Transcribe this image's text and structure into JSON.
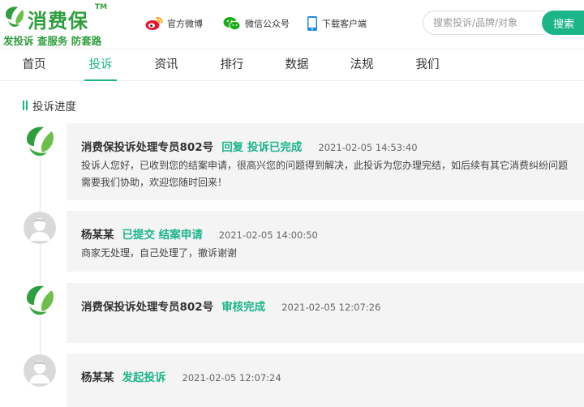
{
  "brand": {
    "title": "消费保",
    "tm": "TM",
    "slogan": "发投诉 查服务 防套路"
  },
  "toplinks": {
    "weibo": "官方微博",
    "wechat": "微信公众号",
    "app": "下载客户端"
  },
  "search": {
    "placeholder": "搜索投诉/品牌/对象",
    "button": "搜索"
  },
  "nav": {
    "items": [
      {
        "label": "首页"
      },
      {
        "label": "投诉"
      },
      {
        "label": "资讯"
      },
      {
        "label": "排行"
      },
      {
        "label": "数据"
      },
      {
        "label": "法规"
      },
      {
        "label": "我们"
      }
    ],
    "active": "投诉"
  },
  "progress": {
    "title": "投诉进度",
    "entries": [
      {
        "avatar": "xiaofeibao-logo",
        "name": "消费保投诉处理专员802号",
        "status": "回复 投诉已完成",
        "time": "2021-02-05 14:53:40",
        "message": "投诉人您好，已收到您的结案申请，很高兴您的问题得到解决，此投诉为您办理完结，如后续有其它消费纠纷问题需要我们协助，欢迎您随时回来！"
      },
      {
        "avatar": "user-avatar",
        "name": "杨某某",
        "status": "已提交 结案申请",
        "time": "2021-02-05 14:00:50",
        "message": "商家无处理，自己处理了，撤诉谢谢"
      },
      {
        "avatar": "xiaofeibao-logo",
        "name": "消费保投诉处理专员802号",
        "status": "审核完成",
        "time": "2021-02-05 12:07:26",
        "message": ""
      },
      {
        "avatar": "user-avatar",
        "name": "杨某某",
        "status": "发起投诉",
        "time": "2021-02-05 12:07:24",
        "message": ""
      }
    ]
  },
  "colors": {
    "accent": "#1cb589",
    "brand_green": "#2e9e3e",
    "card_bg": "#f4f4f4"
  }
}
